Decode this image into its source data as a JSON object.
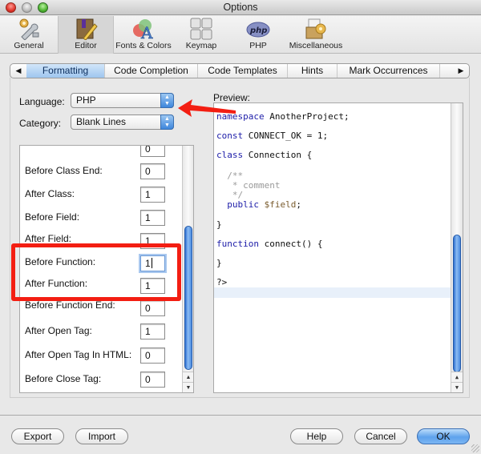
{
  "window": {
    "title": "Options"
  },
  "toolbar": {
    "items": [
      {
        "label": "General",
        "icon": "gear-wrench-icon",
        "active": false
      },
      {
        "label": "Editor",
        "icon": "book-pencil-icon",
        "active": true
      },
      {
        "label": "Fonts & Colors",
        "icon": "fonts-colors-icon",
        "active": false
      },
      {
        "label": "Keymap",
        "icon": "keyboard-keys-icon",
        "active": false
      },
      {
        "label": "PHP",
        "icon": "php-logo-icon",
        "active": false
      },
      {
        "label": "Miscellaneous",
        "icon": "folder-gear-icon",
        "active": false
      }
    ]
  },
  "tabs": {
    "scroll_left": "◀",
    "scroll_right": "▶",
    "items": [
      {
        "label": "Formatting",
        "active": true
      },
      {
        "label": "Code Completion",
        "active": false
      },
      {
        "label": "Code Templates",
        "active": false
      },
      {
        "label": "Hints",
        "active": false
      },
      {
        "label": "Mark Occurrences",
        "active": false
      }
    ]
  },
  "form": {
    "language_label": "Language:",
    "language_value": "PHP",
    "category_label": "Category:",
    "category_value": "Blank Lines"
  },
  "options": {
    "partial_top_value": "0",
    "rows": [
      {
        "label": "Before Class End:",
        "value": "0"
      },
      {
        "label": "After Class:",
        "value": "1"
      },
      {
        "label": "Before Field:",
        "value": "1"
      },
      {
        "label": "After Field:",
        "value": "1"
      },
      {
        "label": "Before Function:",
        "value": "1",
        "focused": true
      },
      {
        "label": "After Function:",
        "value": "1"
      },
      {
        "label": "Before Function End:",
        "value": "0"
      },
      {
        "label": "After Open Tag:",
        "value": "1"
      },
      {
        "label": "After Open Tag In HTML:",
        "value": "0"
      },
      {
        "label": "Before Close Tag:",
        "value": "0"
      }
    ]
  },
  "preview": {
    "label": "Preview:",
    "lines": [
      {
        "parts": [
          {
            "t": "namespace",
            "c": "kw"
          },
          {
            "t": " AnotherProject;",
            "c": ""
          }
        ]
      },
      {
        "parts": [
          {
            "t": "const",
            "c": "kw"
          },
          {
            "t": " CONNECT_OK = 1;",
            "c": ""
          }
        ]
      },
      {
        "parts": [
          {
            "t": "class",
            "c": "kw"
          },
          {
            "t": " Connection {",
            "c": ""
          }
        ]
      },
      {
        "parts": [
          {
            "t": "  /**",
            "c": "cm"
          }
        ]
      },
      {
        "parts": [
          {
            "t": "   * comment",
            "c": "cm"
          }
        ]
      },
      {
        "parts": [
          {
            "t": "   */",
            "c": "cm"
          }
        ]
      },
      {
        "parts": [
          {
            "t": "  public",
            "c": "kw"
          },
          {
            "t": " ",
            "c": ""
          },
          {
            "t": "$field",
            "c": "var"
          },
          {
            "t": ";",
            "c": ""
          }
        ]
      },
      {
        "parts": [
          {
            "t": "}",
            "c": ""
          }
        ]
      },
      {
        "parts": [
          {
            "t": "function",
            "c": "kw"
          },
          {
            "t": " connect() {",
            "c": ""
          }
        ]
      },
      {
        "parts": [
          {
            "t": "}",
            "c": ""
          }
        ]
      },
      {
        "parts": [
          {
            "t": "?>",
            "c": ""
          }
        ]
      }
    ]
  },
  "buttons": {
    "export": "Export",
    "import": "Import",
    "help": "Help",
    "cancel": "Cancel",
    "ok": "OK"
  },
  "annotations": {
    "highlight_color": "#f31e12",
    "arrow_color": "#f31e12"
  }
}
